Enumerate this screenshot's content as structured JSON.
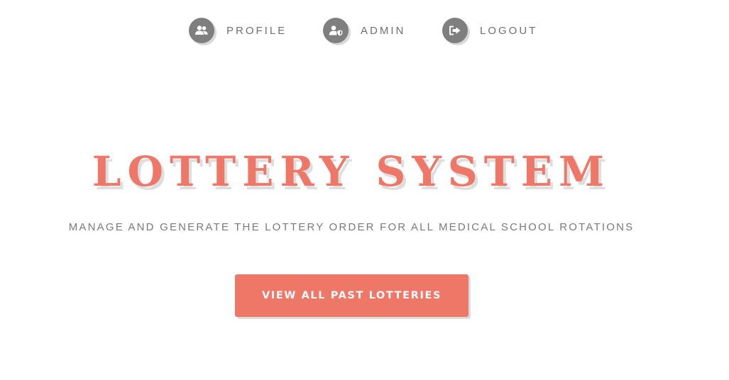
{
  "nav": {
    "items": [
      {
        "label": "PROFILE",
        "icon": "users-icon"
      },
      {
        "label": "ADMIN",
        "icon": "user-shield-icon"
      },
      {
        "label": "LOGOUT",
        "icon": "sign-out-icon"
      }
    ]
  },
  "hero": {
    "title": "LOTTERY SYSTEM",
    "subtitle": "MANAGE AND GENERATE THE LOTTERY ORDER FOR ALL MEDICAL SCHOOL ROTATIONS",
    "cta_label": "VIEW ALL PAST LOTTERIES"
  },
  "colors": {
    "accent": "#ee7768",
    "icon_bg": "#7f7f7f",
    "nav_text": "#6f6f6f",
    "subtitle_text": "#7a7a7a",
    "shadow": "#dedede"
  }
}
